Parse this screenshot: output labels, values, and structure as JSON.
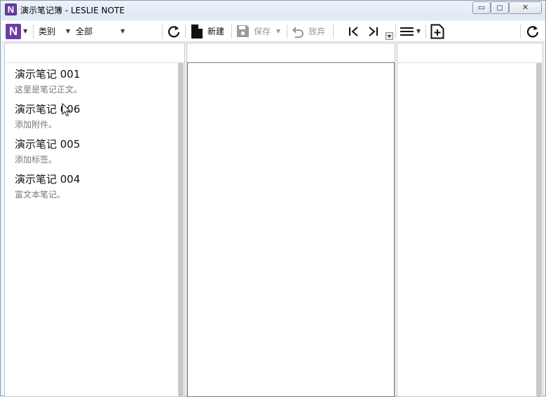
{
  "window": {
    "title": "演示笔记簿 - LESLIE NOTE",
    "logo_letter": "N",
    "controls": {
      "minimize": "▭",
      "maximize": "◻",
      "close": "✕"
    }
  },
  "toolbar": {
    "logo_letter": "N",
    "category_label": "类别",
    "filter_label": "全部",
    "new_label": "新建",
    "save_label": "保存",
    "discard_label": "放弃",
    "icons": [
      "refresh-icon",
      "new-note-icon",
      "save-icon",
      "undo-icon",
      "first-icon",
      "last-icon",
      "menu-icon",
      "add-page-icon",
      "refresh-icon"
    ]
  },
  "notes": [
    {
      "title": "演示笔记 001",
      "body": "这里是笔记正文。"
    },
    {
      "title": "演示笔记 006",
      "body": "添加附件。"
    },
    {
      "title": "演示笔记 005",
      "body": "添加标签。"
    },
    {
      "title": "演示笔记 004",
      "body": "富文本笔记。"
    }
  ],
  "colors": {
    "brand": "#6b3fa0",
    "text": "#111111",
    "subtext": "#777777",
    "disabled": "#9a9a9a"
  }
}
